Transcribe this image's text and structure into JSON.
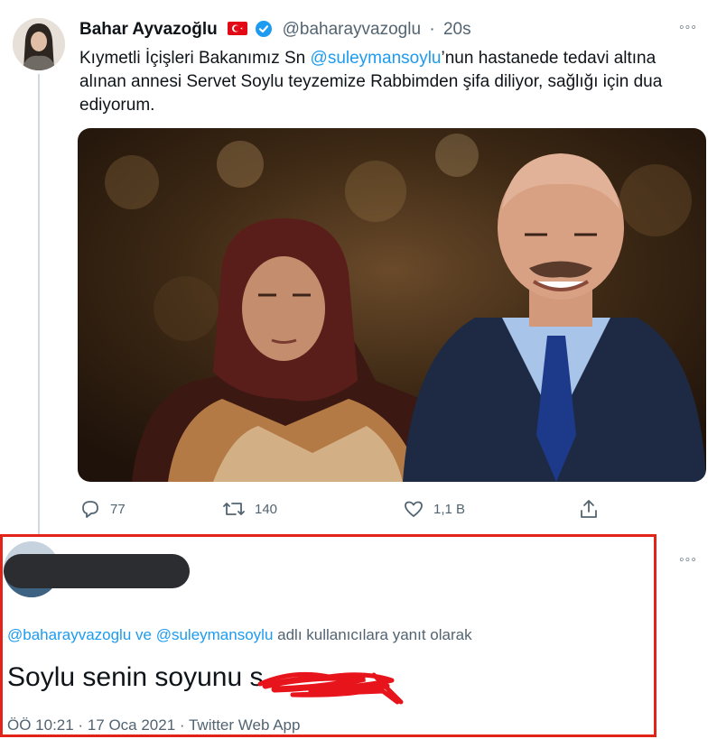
{
  "tweet": {
    "author_name": "Bahar Ayvazoğlu",
    "handle": "@baharayvazoglu",
    "separator": "·",
    "time": "20s",
    "text_before": "Kıymetli İçişleri Bakanımız Sn ",
    "mention": "@suleymansoylu",
    "text_after": "’nun hastanede tedavi altına alınan annesi Servet Soylu teyzemize Rabbimden şifa diliyor, sağlığı için dua ediyorum.",
    "more_glyph": "◦◦◦",
    "stats": {
      "replies": "77",
      "retweets": "140",
      "likes": "1,1 B"
    }
  },
  "reply": {
    "more_glyph": "◦◦◦",
    "replying_mention_1": "@baharayvazoglu",
    "replying_and": " ve ",
    "replying_mention_2": "@suleymansoylu",
    "replying_suffix": " adlı kullanıcılara yanıt olarak",
    "text": "Soylu senin soyunu s",
    "meta": "ÖÖ 10:21 · 17 Oca 2021 · Twitter Web App"
  },
  "colors": {
    "accent": "#1d9bf0",
    "highlight_box": "#e2231a",
    "redaction": "#e8141c"
  },
  "icons": [
    "flag-icon",
    "verified-icon",
    "more-icon",
    "reply-icon",
    "retweet-icon",
    "like-icon",
    "share-icon"
  ]
}
